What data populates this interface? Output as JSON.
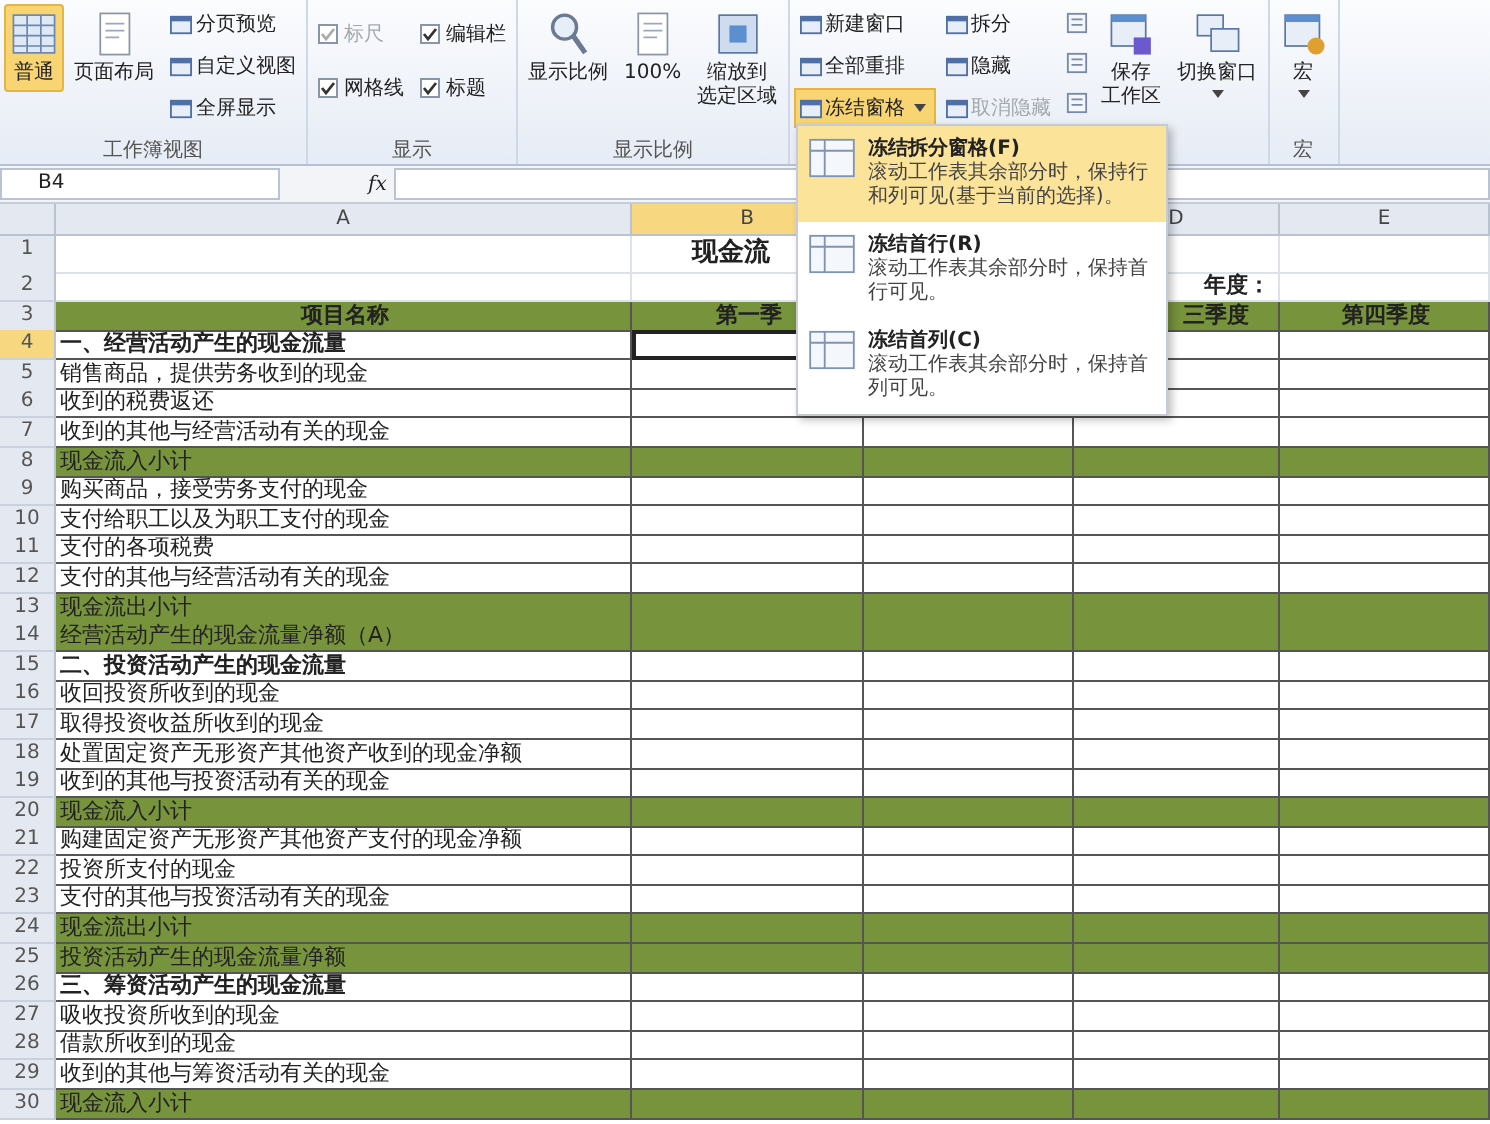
{
  "ribbon": {
    "groups": [
      {
        "label": "工作簿视图",
        "columns": [
          [
            {
              "kind": "large",
              "lines": [
                "普通"
              ],
              "selected": true,
              "dropdown": false
            }
          ],
          [
            {
              "kind": "large",
              "lines": [
                "页面布局"
              ],
              "selected": false,
              "dropdown": false
            }
          ],
          [
            {
              "kind": "small",
              "label": "分页预览",
              "selected": false,
              "disabled": false,
              "dropdown": false
            },
            {
              "kind": "small",
              "label": "自定义视图",
              "selected": false,
              "disabled": false,
              "dropdown": false
            },
            {
              "kind": "small",
              "label": "全屏显示",
              "selected": false,
              "disabled": false,
              "dropdown": false
            }
          ]
        ]
      },
      {
        "label": "显示",
        "columns": [
          [
            {
              "kind": "check",
              "label": "标尺",
              "checked": true,
              "disabled": true
            },
            {
              "kind": "check",
              "label": "网格线",
              "checked": true,
              "disabled": false
            }
          ],
          [
            {
              "kind": "check",
              "label": "编辑栏",
              "checked": true,
              "disabled": false
            },
            {
              "kind": "check",
              "label": "标题",
              "checked": true,
              "disabled": false
            }
          ]
        ]
      },
      {
        "label": "显示比例",
        "columns": [
          [
            {
              "kind": "large",
              "lines": [
                "显示比例"
              ],
              "selected": false,
              "dropdown": false
            }
          ],
          [
            {
              "kind": "large",
              "lines": [
                "100%"
              ],
              "selected": false,
              "dropdown": false
            }
          ],
          [
            {
              "kind": "large",
              "lines": [
                "缩放到",
                "选定区域"
              ],
              "selected": false,
              "dropdown": false
            }
          ]
        ]
      },
      {
        "columns": [
          [
            {
              "kind": "small",
              "label": "新建窗口",
              "selected": false,
              "disabled": false,
              "dropdown": false
            },
            {
              "kind": "small",
              "label": "全部重排",
              "selected": false,
              "disabled": false,
              "dropdown": false
            },
            {
              "kind": "small",
              "label": "冻结窗格",
              "selected": true,
              "disabled": false,
              "dropdown": true
            }
          ],
          [
            {
              "kind": "small",
              "label": "拆分",
              "selected": false,
              "disabled": false,
              "dropdown": false
            },
            {
              "kind": "small",
              "label": "隐藏",
              "selected": false,
              "disabled": false,
              "dropdown": false
            },
            {
              "kind": "small",
              "label": "取消隐藏",
              "selected": false,
              "disabled": true,
              "dropdown": false
            }
          ],
          [
            {
              "kind": "icon"
            },
            {
              "kind": "icon"
            },
            {
              "kind": "icon"
            }
          ],
          [
            {
              "kind": "large",
              "lines": [
                "保存",
                "工作区"
              ],
              "selected": false,
              "dropdown": false
            }
          ],
          [
            {
              "kind": "large",
              "lines": [
                "切换窗口"
              ],
              "selected": false,
              "dropdown": true
            }
          ]
        ]
      },
      {
        "label": "宏",
        "columns": [
          [
            {
              "kind": "large",
              "lines": [
                "宏"
              ],
              "selected": false,
              "dropdown": true
            }
          ]
        ]
      }
    ]
  },
  "formula_bar": {
    "name_box": "B4",
    "fx": "fx"
  },
  "sheet": {
    "columns": [
      {
        "kind": "header",
        "label": "A",
        "selected": false
      },
      {
        "kind": "header",
        "label": "B",
        "selected": true
      },
      {
        "kind": "covered"
      },
      {
        "kind": "header",
        "label": "D",
        "selected": false
      },
      {
        "kind": "header",
        "label": "E",
        "selected": false
      }
    ],
    "rows": [
      {
        "num": "1",
        "kind": "title",
        "selected": false,
        "cells": [
          "",
          "现金流",
          "",
          "",
          ""
        ]
      },
      {
        "num": "2",
        "kind": "plain",
        "selected": false,
        "cells": [
          "",
          "",
          "",
          "年度：",
          ""
        ]
      },
      {
        "num": "3",
        "kind": "header",
        "selected": false,
        "cells": [
          "项目名称",
          "第一季",
          "",
          "三季度",
          "第四季度"
        ]
      },
      {
        "num": "4",
        "kind": "section",
        "selected": true,
        "cells": [
          "一、经营活动产生的现金流量",
          "",
          "",
          "",
          ""
        ]
      },
      {
        "num": "5",
        "kind": "item",
        "selected": false,
        "cells": [
          "销售商品，提供劳务收到的现金",
          "",
          "",
          "",
          ""
        ]
      },
      {
        "num": "6",
        "kind": "item",
        "selected": false,
        "cells": [
          "收到的税费返还",
          "",
          "",
          "",
          ""
        ]
      },
      {
        "num": "7",
        "kind": "item",
        "selected": false,
        "cells": [
          "收到的其他与经营活动有关的现金",
          "",
          "",
          "",
          ""
        ]
      },
      {
        "num": "8",
        "kind": "subtotal",
        "selected": false,
        "cells": [
          "现金流入小计",
          "",
          "",
          "",
          ""
        ]
      },
      {
        "num": "9",
        "kind": "item",
        "selected": false,
        "cells": [
          "购买商品，接受劳务支付的现金",
          "",
          "",
          "",
          ""
        ]
      },
      {
        "num": "10",
        "kind": "item",
        "selected": false,
        "cells": [
          "支付给职工以及为职工支付的现金",
          "",
          "",
          "",
          ""
        ]
      },
      {
        "num": "11",
        "kind": "item",
        "selected": false,
        "cells": [
          "支付的各项税费",
          "",
          "",
          "",
          ""
        ]
      },
      {
        "num": "12",
        "kind": "item",
        "selected": false,
        "cells": [
          "支付的其他与经营活动有关的现金",
          "",
          "",
          "",
          ""
        ]
      },
      {
        "num": "13",
        "kind": "subtotal",
        "selected": false,
        "cells": [
          "现金流出小计",
          "",
          "",
          "",
          ""
        ]
      },
      {
        "num": "14",
        "kind": "subtotal",
        "selected": false,
        "cells": [
          "经营活动产生的现金流量净额（A）",
          "",
          "",
          "",
          ""
        ]
      },
      {
        "num": "15",
        "kind": "section",
        "selected": false,
        "cells": [
          "二、投资活动产生的现金流量",
          "",
          "",
          "",
          ""
        ]
      },
      {
        "num": "16",
        "kind": "item",
        "selected": false,
        "cells": [
          "收回投资所收到的现金",
          "",
          "",
          "",
          ""
        ]
      },
      {
        "num": "17",
        "kind": "item",
        "selected": false,
        "cells": [
          "取得投资收益所收到的现金",
          "",
          "",
          "",
          ""
        ]
      },
      {
        "num": "18",
        "kind": "item",
        "selected": false,
        "cells": [
          "处置固定资产无形资产其他资产收到的现金净额",
          "",
          "",
          "",
          ""
        ]
      },
      {
        "num": "19",
        "kind": "item",
        "selected": false,
        "cells": [
          "收到的其他与投资活动有关的现金",
          "",
          "",
          "",
          ""
        ]
      },
      {
        "num": "20",
        "kind": "subtotal",
        "selected": false,
        "cells": [
          "现金流入小计",
          "",
          "",
          "",
          ""
        ]
      },
      {
        "num": "21",
        "kind": "item",
        "selected": false,
        "cells": [
          "购建固定资产无形资产其他资产支付的现金净额",
          "",
          "",
          "",
          ""
        ]
      },
      {
        "num": "22",
        "kind": "item",
        "selected": false,
        "cells": [
          "投资所支付的现金",
          "",
          "",
          "",
          ""
        ]
      },
      {
        "num": "23",
        "kind": "item",
        "selected": false,
        "cells": [
          "支付的其他与投资活动有关的现金",
          "",
          "",
          "",
          ""
        ]
      },
      {
        "num": "24",
        "kind": "subtotal",
        "selected": false,
        "cells": [
          "现金流出小计",
          "",
          "",
          "",
          ""
        ]
      },
      {
        "num": "25",
        "kind": "subtotal",
        "selected": false,
        "cells": [
          "投资活动产生的现金流量净额",
          "",
          "",
          "",
          ""
        ]
      },
      {
        "num": "26",
        "kind": "section",
        "selected": false,
        "cells": [
          "三、筹资活动产生的现金流量",
          "",
          "",
          "",
          ""
        ]
      },
      {
        "num": "27",
        "kind": "item",
        "selected": false,
        "cells": [
          "吸收投资所收到的现金",
          "",
          "",
          "",
          ""
        ]
      },
      {
        "num": "28",
        "kind": "item",
        "selected": false,
        "cells": [
          "借款所收到的现金",
          "",
          "",
          "",
          ""
        ]
      },
      {
        "num": "29",
        "kind": "item",
        "selected": false,
        "cells": [
          "收到的其他与筹资活动有关的现金",
          "",
          "",
          "",
          ""
        ]
      },
      {
        "num": "30",
        "kind": "subtotal",
        "selected": false,
        "cells": [
          "现金流入小计",
          "",
          "",
          "",
          ""
        ]
      }
    ]
  },
  "dropdown": {
    "items": [
      {
        "title": "冻结拆分窗格(F)",
        "description": "滚动工作表其余部分时，保持行和列可见(基于当前的选择)。",
        "selected": true
      },
      {
        "title": "冻结首行(R)",
        "description": "滚动工作表其余部分时，保持首行可见。",
        "selected": false
      },
      {
        "title": "冻结首列(C)",
        "description": "滚动工作表其余部分时，保持首列可见。",
        "selected": false
      }
    ]
  }
}
